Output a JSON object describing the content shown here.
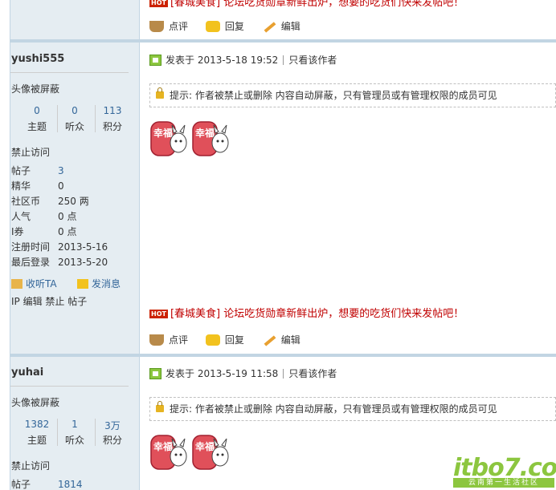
{
  "posts": [
    {
      "id": "top",
      "hot_text": "[春城美食] 论坛吃货勋章新鲜出炉，想要的吃货们快来发帖吧！",
      "actions": [
        "点评",
        "回复",
        "编辑"
      ]
    },
    {
      "username": "yushi555",
      "avatar_blocked": "头像被屏蔽",
      "stats": [
        {
          "value": "0",
          "label": "主题"
        },
        {
          "value": "0",
          "label": "听众"
        },
        {
          "value": "113",
          "label": "积分"
        }
      ],
      "access": "禁止访问",
      "fields": [
        {
          "k": "帖子",
          "v": "3",
          "link": true
        },
        {
          "k": "精华",
          "v": "0"
        },
        {
          "k": "社区币",
          "v": "250 两"
        },
        {
          "k": "人气",
          "v": "0 点"
        },
        {
          "k": "I券",
          "v": "0 点"
        },
        {
          "k": "注册时间",
          "v": "2013-5-16"
        },
        {
          "k": "最后登录",
          "v": "2013-5-20"
        }
      ],
      "side_actions": [
        "收听TA",
        "发消息"
      ],
      "admin_links": "IP 编辑 禁止 帖子",
      "posted_at": "发表于 2013-5-18 19:52",
      "author_only": "只看该作者",
      "notice": "提示: 作者被禁止或删除 内容自动屏蔽，只有管理员或有管理权限的成员可见",
      "emoji_text": "幸福",
      "hot_text": "[春城美食] 论坛吃货勋章新鲜出炉，想要的吃货们快来发帖吧！",
      "hot_badge": "HOT",
      "actions": [
        "点评",
        "回复",
        "编辑"
      ]
    },
    {
      "username": "yuhai",
      "avatar_blocked": "头像被屏蔽",
      "stats": [
        {
          "value": "1382",
          "label": "主题"
        },
        {
          "value": "1",
          "label": "听众"
        },
        {
          "value": "3万",
          "label": "积分"
        }
      ],
      "access": "禁止访问",
      "fields": [
        {
          "k": "帖子",
          "v": "1814",
          "link": true
        }
      ],
      "posted_at": "发表于 2013-5-19 11:58",
      "author_only": "只看该作者",
      "notice": "提示: 作者被禁止或删除 内容自动屏蔽，只有管理员或有管理权限的成员可见",
      "emoji_text": "幸福"
    }
  ],
  "watermark": {
    "main": "itbo7.com",
    "sub": "云南第一生活社区"
  },
  "colors": {
    "side_bg": "#e5edf2",
    "border": "#c2d5e3",
    "link": "#336699",
    "hot": "#c00000"
  }
}
